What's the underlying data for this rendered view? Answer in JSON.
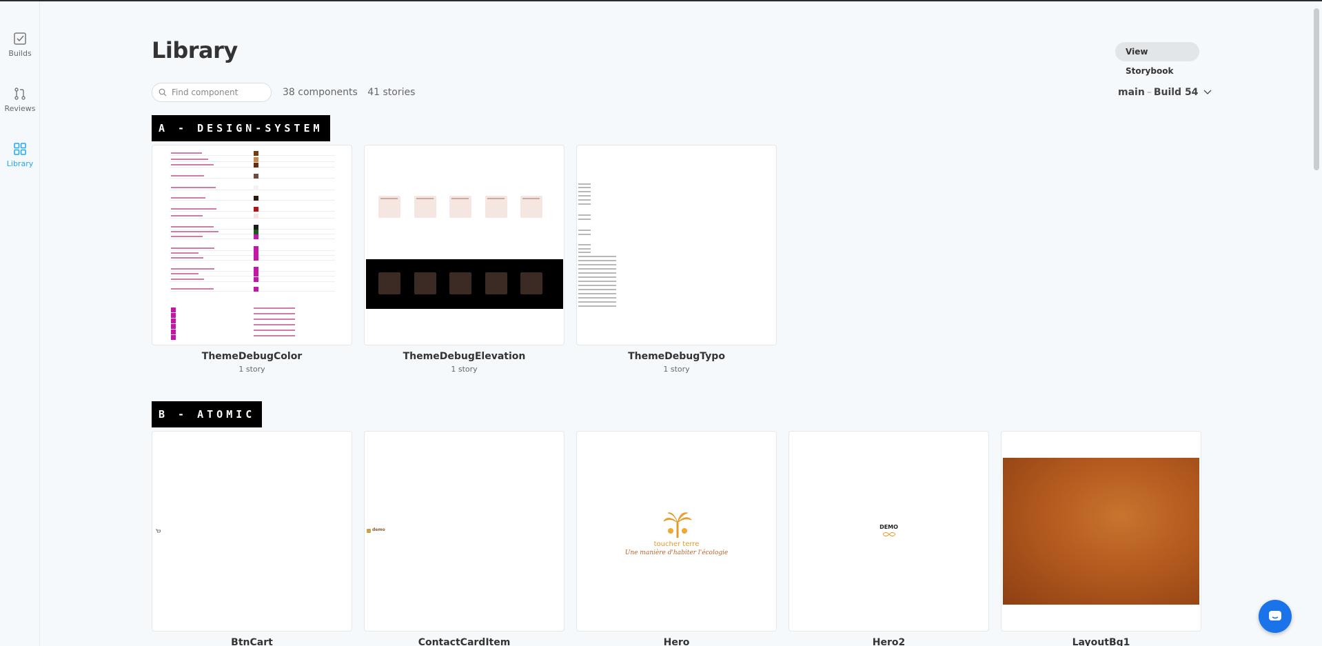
{
  "sidebar": {
    "items": [
      {
        "label": "Builds",
        "icon": "checkbox-icon",
        "active": false
      },
      {
        "label": "Reviews",
        "icon": "pull-request-icon",
        "active": false
      },
      {
        "label": "Library",
        "icon": "grid-icon",
        "active": true
      }
    ]
  },
  "header": {
    "title": "Library",
    "view_storybook": "View Storybook"
  },
  "toolbar": {
    "search_placeholder": "Find component",
    "components_count": "38 components",
    "stories_count": "41 stories",
    "branch": "main",
    "build": "Build 54"
  },
  "sections": [
    {
      "label": "A - DESIGN-SYSTEM",
      "components": [
        {
          "name": "ThemeDebugColor",
          "stories": "1 story"
        },
        {
          "name": "ThemeDebugElevation",
          "stories": "1 story"
        },
        {
          "name": "ThemeDebugTypo",
          "stories": "1 story"
        }
      ]
    },
    {
      "label": "B - ATOMIC",
      "components": [
        {
          "name": "BtnCart",
          "stories": ""
        },
        {
          "name": "ContactCardItem",
          "stories": ""
        },
        {
          "name": "Hero",
          "stories": ""
        },
        {
          "name": "Hero2",
          "stories": ""
        },
        {
          "name": "LayoutBg1",
          "stories": ""
        }
      ]
    }
  ],
  "previews": {
    "elevation_labels": [
      "Elevation 1",
      "Elevation 2",
      "Elevation 3",
      "Elevation 4",
      "Elevation 5"
    ],
    "hero_brand": "toucher terre",
    "hero_tagline": "Une manière d'habiter l'écologie",
    "hero2_brand": "DEMO",
    "contact_label": "demo"
  },
  "colors": {
    "accent": "#1ea7fd",
    "section_bg": "#000000",
    "fab": "#1a73e8"
  }
}
